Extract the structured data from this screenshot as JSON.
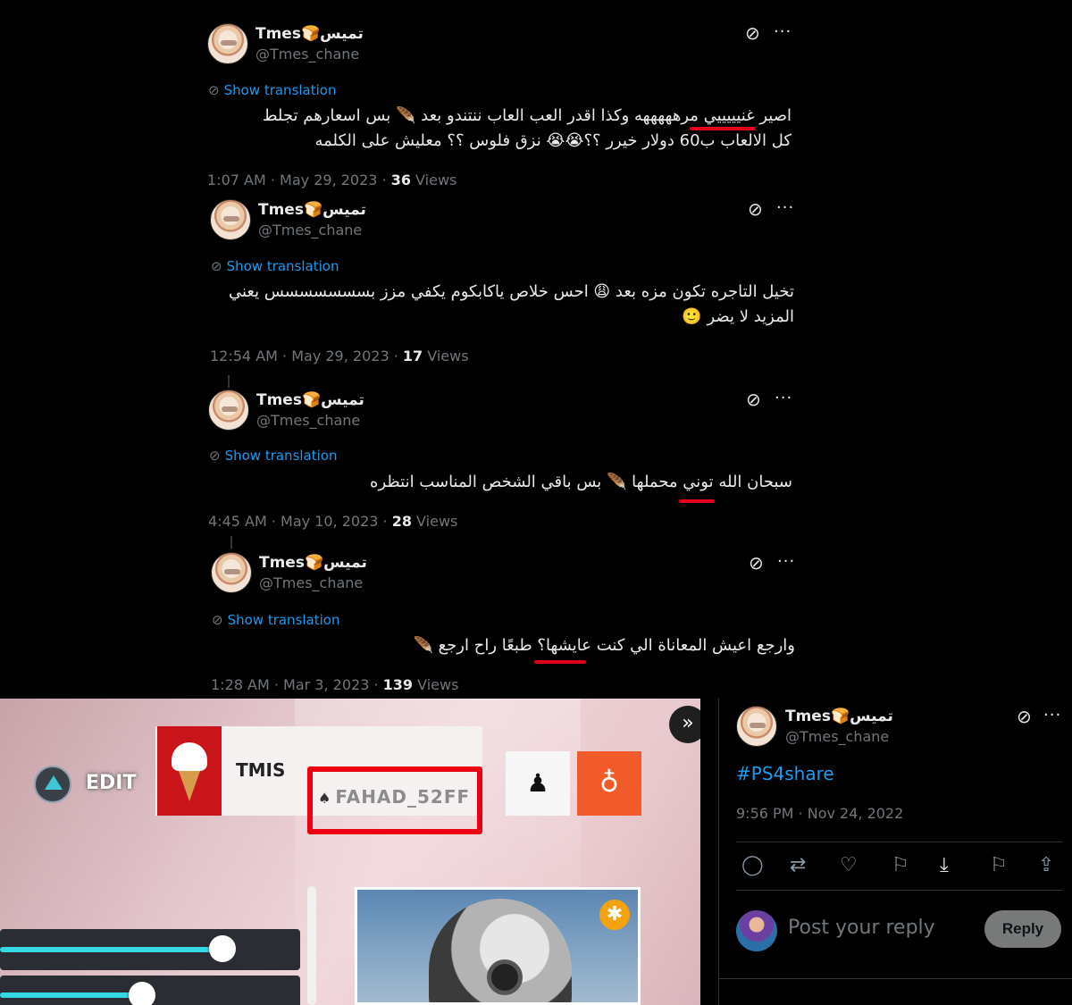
{
  "tweets": [
    {
      "name": "Tmes🍞تميس",
      "handle": "@Tmes_chane",
      "show_translation": "Show translation",
      "line1": "اصير غنيييييي مرهههههه وكذا اقدر العب العاب ننتندو بعد 🪶 بس اسعارهم تجلط",
      "line2": "كل الالعاب ب60 دولار خيرر ؟؟😭😭 نزق فلوس ؟؟ معليش على الكلمه",
      "time": "1:07 AM · May 29, 2023 · ",
      "views_count": "36",
      "views_label": " Views"
    },
    {
      "name": "Tmes🍞تميس",
      "handle": "@Tmes_chane",
      "show_translation": "Show translation",
      "line1": "تخيل التاجره تكون مزه بعد 😩 احس خلاص ياكابكوم يكفي مزز  بسسسسسسس يعني",
      "line2": "المزيد لا يضر 🙂",
      "time": "12:54 AM · May 29, 2023 · ",
      "views_count": "17",
      "views_label": " Views"
    },
    {
      "name": "Tmes🍞تميس",
      "handle": "@Tmes_chane",
      "show_translation": "Show translation",
      "line1": "سبحان الله توني محملها 🪶 بس باقي الشخص المناسب انتظره",
      "time": "4:45 AM · May 10, 2023 · ",
      "views_count": "28",
      "views_label": " Views"
    },
    {
      "name": "Tmes🍞تميس",
      "handle": "@Tmes_chane",
      "show_translation": "Show translation",
      "line1": "وارجع اعيش المعاناة الي كنت عايشها؟ طبعًا راح ارجع 🪶",
      "time": "1:28 AM · Mar 3, 2023 · ",
      "views_count": "139",
      "views_label": " Views"
    }
  ],
  "ps4": {
    "edit_label": "EDIT",
    "profile_name": "TMIS",
    "psn_id": "FAHAD_52FF",
    "slider1_level": 0.83,
    "slider2_level": 0.53
  },
  "share_tweet": {
    "name": "Tmes🍞تميس",
    "handle": "@Tmes_chane",
    "hashtag": "#PS4share",
    "time": "9:56 PM · Nov 24, 2022",
    "reply_placeholder": "Post your reply",
    "reply_button": "Reply"
  },
  "icons": {
    "grok": "grok-icon",
    "more": "more-icon",
    "translate": "globe-icon",
    "reply": "reply-icon",
    "retweet": "retweet-icon",
    "like": "like-icon",
    "bookmark": "bookmark-icon",
    "download": "download-icon",
    "share": "share-icon"
  },
  "colors": {
    "background": "#000000",
    "link": "#1d9bf0",
    "muted": "#71767b",
    "highlight": "#e0001b",
    "ps_cyan": "#34d9e4",
    "trophy_orange": "#f15a29"
  }
}
